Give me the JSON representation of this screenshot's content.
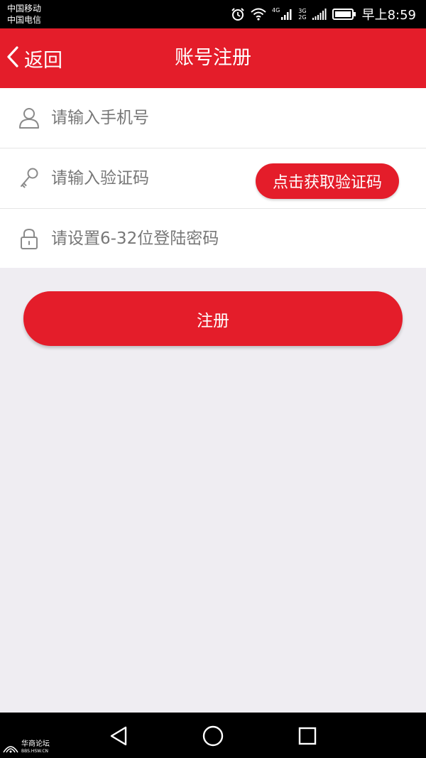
{
  "status_bar": {
    "carrier_1": "中国移动",
    "carrier_2": "中国电信",
    "network_badge": "4G",
    "network_top": "3G",
    "network_bottom": "2G",
    "time": "早上8:59",
    "icons": [
      "alarm-icon",
      "wifi-icon",
      "signal-icon",
      "battery-icon"
    ]
  },
  "header": {
    "back_label": "返回",
    "title": "账号注册"
  },
  "form": {
    "phone_placeholder": "请输入手机号",
    "code_placeholder": "请输入验证码",
    "get_code_label": "点击获取验证码",
    "password_placeholder": "请设置6-32位登陆密码",
    "icons": [
      "user-icon",
      "key-icon",
      "lock-icon"
    ]
  },
  "submit_label": "注册",
  "watermark": {
    "name": "华商论坛",
    "url": "BBS.HSW.CN"
  },
  "colors": {
    "accent": "#e41d2a",
    "background": "#efedf2",
    "form_background": "#ffffff",
    "placeholder": "#777777"
  }
}
